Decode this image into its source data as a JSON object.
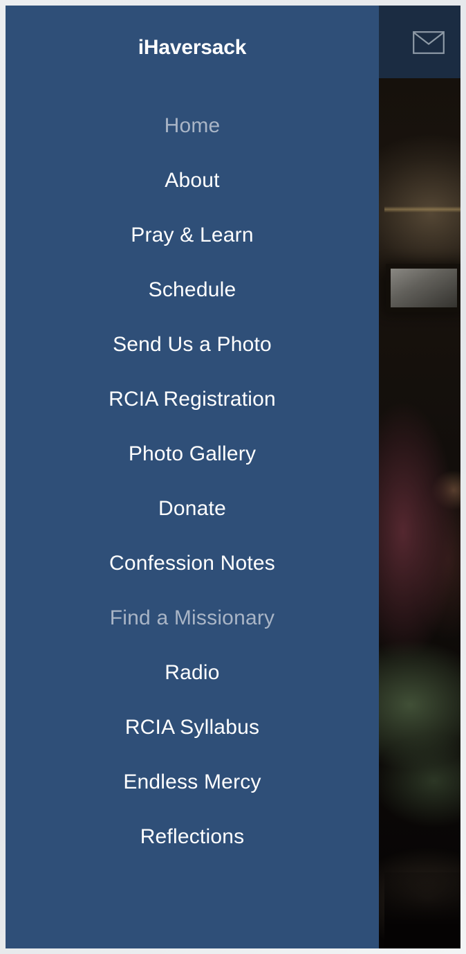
{
  "brand": {
    "title": "iHaversack"
  },
  "header": {
    "mail_icon": "envelope-icon",
    "background_color": "#1b2c42"
  },
  "nav": {
    "background_color": "#2f4f78",
    "active_color": "#ffffff",
    "dim_color": "#a9b5c6",
    "items": [
      {
        "label": "Home",
        "state": "dim"
      },
      {
        "label": "About",
        "state": "normal"
      },
      {
        "label": "Pray & Learn",
        "state": "normal"
      },
      {
        "label": "Schedule",
        "state": "normal"
      },
      {
        "label": "Send Us a Photo",
        "state": "normal"
      },
      {
        "label": "RCIA Registration",
        "state": "normal"
      },
      {
        "label": "Photo Gallery",
        "state": "normal"
      },
      {
        "label": "Donate",
        "state": "normal"
      },
      {
        "label": "Confession Notes",
        "state": "normal"
      },
      {
        "label": "Find a Missionary",
        "state": "dim"
      },
      {
        "label": "Radio",
        "state": "normal"
      },
      {
        "label": "RCIA Syllabus",
        "state": "normal"
      },
      {
        "label": "Endless Mercy",
        "state": "normal"
      },
      {
        "label": "Reflections",
        "state": "normal"
      }
    ]
  },
  "background": {
    "description": "dark church interior photograph"
  }
}
